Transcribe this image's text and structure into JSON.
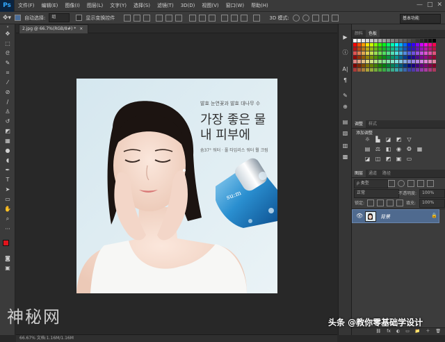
{
  "app": {
    "logo": "Ps"
  },
  "menu": [
    "文件(F)",
    "编辑(E)",
    "图像(I)",
    "图层(L)",
    "文字(Y)",
    "选择(S)",
    "滤镜(T)",
    "3D(D)",
    "视图(V)",
    "窗口(W)",
    "帮助(H)"
  ],
  "window_controls": [
    "—",
    "□",
    "✕"
  ],
  "options": {
    "auto_select_label": "自动选择:",
    "auto_select_value": "组",
    "show_transform_label": "显示变换控件",
    "mode_3d_label": "3D 模式:",
    "workspace": "基本功能"
  },
  "document": {
    "tab_title": "2.jpg @ 66.7%(RGB/8#) *",
    "status": "66.67%     文档:1.16M/1.16M"
  },
  "image": {
    "headline_small": "발효 눈연꽃과 발효 대나무 수",
    "headline_line1": "가장 좋은 물",
    "headline_line2": "내 피부에",
    "subline": "숨37° 워터 · 풀 타임리스 워터 뭘 크림",
    "product_logo": "su:m"
  },
  "panels": {
    "color_tabs": [
      "颜料",
      "色板"
    ],
    "adjust_tabs": [
      "调整",
      "样式"
    ],
    "adjust_title": "添加调整",
    "layers_tabs": [
      "图层",
      "通道",
      "路径"
    ],
    "kind_filter": "ρ 类型",
    "blend_mode": "正常",
    "opacity_label": "不透明度:",
    "opacity_value": "100%",
    "lock_label": "锁定:",
    "fill_label": "填充:",
    "fill_value": "100%",
    "layer_name": "背景",
    "footer_icons": [
      "fx",
      "◐",
      "▭",
      "📁",
      "＋",
      "🗑"
    ]
  },
  "watermarks": {
    "left": "神秘网",
    "right": "头条 @教你零基础学设计"
  },
  "colors": {
    "foreground": "#e0141c",
    "background": "#ffffff",
    "selected_layer": "#4f6a8f"
  }
}
